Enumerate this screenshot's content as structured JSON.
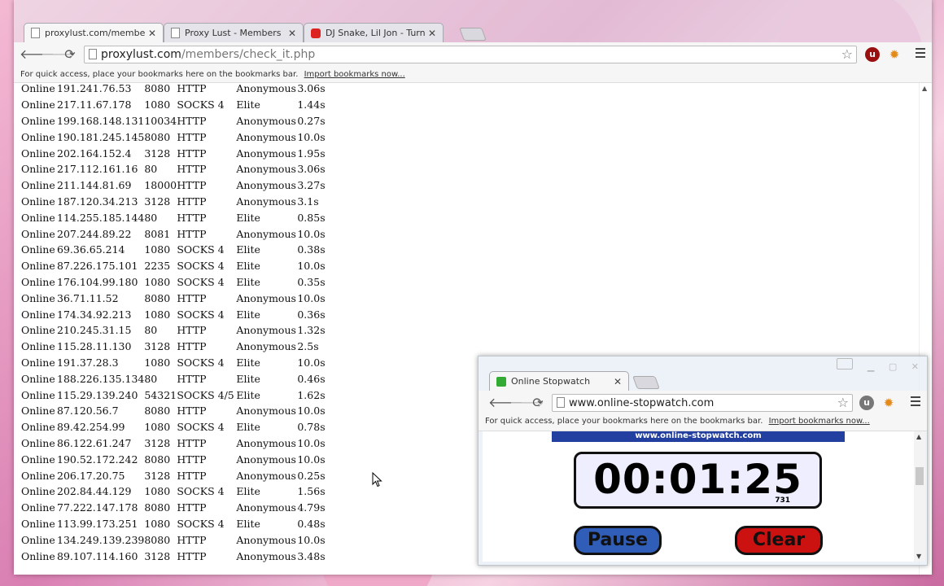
{
  "browser": {
    "tabs": [
      {
        "title": "proxylust.com/members/c",
        "icon": "page-icon",
        "active": true
      },
      {
        "title": "Proxy Lust - Members Pa",
        "icon": "page-icon",
        "active": false
      },
      {
        "title": "DJ Snake, Lil Jon - Turn",
        "icon": "youtube-icon",
        "active": false
      }
    ],
    "close_glyph": "✕",
    "url_host": "proxylust.com",
    "url_path": "/members/check_it.php",
    "bookmarks_text": "For quick access, place your bookmarks here on the bookmarks bar.",
    "bookmarks_link": "Import bookmarks now..."
  },
  "proxies": [
    [
      "Online",
      "191.241.76.53",
      "8080",
      "HTTP",
      "Anonymous",
      "3.06s"
    ],
    [
      "Online",
      "217.11.67.178",
      "1080",
      "SOCKS 4",
      "Elite",
      "1.44s"
    ],
    [
      "Online",
      "199.168.148.131",
      "10034",
      "HTTP",
      "Anonymous",
      "0.27s"
    ],
    [
      "Online",
      "190.181.245.145",
      "8080",
      "HTTP",
      "Anonymous",
      "10.0s"
    ],
    [
      "Online",
      "202.164.152.4",
      "3128",
      "HTTP",
      "Anonymous",
      "1.95s"
    ],
    [
      "Online",
      "217.112.161.16",
      "80",
      "HTTP",
      "Anonymous",
      "3.06s"
    ],
    [
      "Online",
      "211.144.81.69",
      "18000",
      "HTTP",
      "Anonymous",
      "3.27s"
    ],
    [
      "Online",
      "187.120.34.213",
      "3128",
      "HTTP",
      "Anonymous",
      "3.1s"
    ],
    [
      "Online",
      "114.255.185.144",
      "80",
      "HTTP",
      "Elite",
      "0.85s"
    ],
    [
      "Online",
      "207.244.89.22",
      "8081",
      "HTTP",
      "Anonymous",
      "10.0s"
    ],
    [
      "Online",
      "69.36.65.214",
      "1080",
      "SOCKS 4",
      "Elite",
      "0.38s"
    ],
    [
      "Online",
      "87.226.175.101",
      "2235",
      "SOCKS 4",
      "Elite",
      "10.0s"
    ],
    [
      "Online",
      "176.104.99.180",
      "1080",
      "SOCKS 4",
      "Elite",
      "0.35s"
    ],
    [
      "Online",
      "36.71.11.52",
      "8080",
      "HTTP",
      "Anonymous",
      "10.0s"
    ],
    [
      "Online",
      "174.34.92.213",
      "1080",
      "SOCKS 4",
      "Elite",
      "0.36s"
    ],
    [
      "Online",
      "210.245.31.15",
      "80",
      "HTTP",
      "Anonymous",
      "1.32s"
    ],
    [
      "Online",
      "115.28.11.130",
      "3128",
      "HTTP",
      "Anonymous",
      "2.5s"
    ],
    [
      "Online",
      "191.37.28.3",
      "1080",
      "SOCKS 4",
      "Elite",
      "10.0s"
    ],
    [
      "Online",
      "188.226.135.134",
      "80",
      "HTTP",
      "Elite",
      "0.46s"
    ],
    [
      "Online",
      "115.29.139.240",
      "54321",
      "SOCKS 4/5",
      "Elite",
      "1.62s"
    ],
    [
      "Online",
      "87.120.56.7",
      "8080",
      "HTTP",
      "Anonymous",
      "10.0s"
    ],
    [
      "Online",
      "89.42.254.99",
      "1080",
      "SOCKS 4",
      "Elite",
      "0.78s"
    ],
    [
      "Online",
      "86.122.61.247",
      "3128",
      "HTTP",
      "Anonymous",
      "10.0s"
    ],
    [
      "Online",
      "190.52.172.242",
      "8080",
      "HTTP",
      "Anonymous",
      "10.0s"
    ],
    [
      "Online",
      "206.17.20.75",
      "3128",
      "HTTP",
      "Anonymous",
      "0.25s"
    ],
    [
      "Online",
      "202.84.44.129",
      "1080",
      "SOCKS 4",
      "Elite",
      "1.56s"
    ],
    [
      "Online",
      "77.222.147.178",
      "8080",
      "HTTP",
      "Anonymous",
      "4.79s"
    ],
    [
      "Online",
      "113.99.173.251",
      "1080",
      "SOCKS 4",
      "Elite",
      "0.48s"
    ],
    [
      "Online",
      "134.249.139.239",
      "8080",
      "HTTP",
      "Anonymous",
      "10.0s"
    ],
    [
      "Online",
      "89.107.114.160",
      "3128",
      "HTTP",
      "Anonymous",
      "3.48s"
    ]
  ],
  "stopwatch_window": {
    "tab_title": "Online Stopwatch",
    "url": "www.online-stopwatch.com",
    "bookmarks_text": "For quick access, place your bookmarks here on the bookmarks bar.",
    "bookmarks_link": "Import bookmarks now...",
    "banner": "www.online-stopwatch.com",
    "time": "00:01:25",
    "ms": "731",
    "pause_label": "Pause",
    "clear_label": "Clear"
  },
  "colors": {
    "pause": "#2f5db8",
    "clear": "#c11111",
    "banner": "#2340a0"
  }
}
